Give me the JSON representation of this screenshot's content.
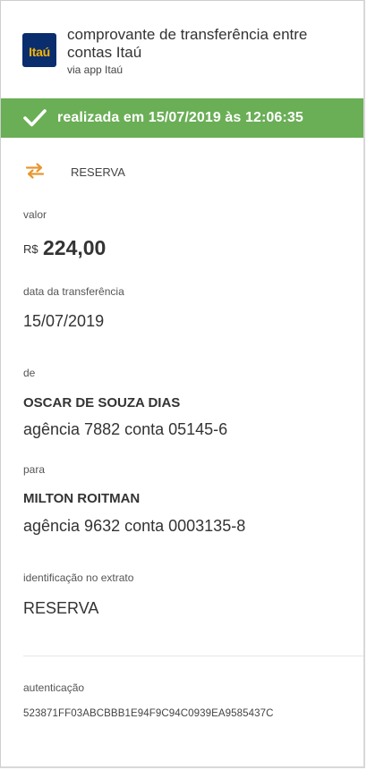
{
  "header": {
    "logo_text": "Itaú",
    "title": "comprovante de transferência entre contas Itaú",
    "subtitle": "via app Itaú"
  },
  "status": {
    "text": "realizada em 15/07/2019 às 12:06:35",
    "color": "#6aae56"
  },
  "transfer": {
    "icon": "transfer-arrows-icon",
    "description": "RESERVA"
  },
  "amount": {
    "label": "valor",
    "currency": "R$",
    "value": "224,00"
  },
  "date": {
    "label": "data da transferência",
    "value": "15/07/2019"
  },
  "from": {
    "label": "de",
    "name": "OSCAR DE SOUZA DIAS",
    "account": "agência 7882 conta 05145-6"
  },
  "to": {
    "label": "para",
    "name": "MILTON ROITMAN",
    "account": "agência 9632 conta 0003135-8"
  },
  "statement": {
    "label": "identificação no extrato",
    "value": "RESERVA"
  },
  "authentication": {
    "label": "autenticação",
    "code": "523871FF03ABCBBB1E94F9C94C0939EA9585437C"
  },
  "colors": {
    "brand_blue": "#0a2d6e",
    "brand_orange": "#f7b500",
    "success_green": "#6aae56",
    "icon_orange": "#e8962f"
  }
}
